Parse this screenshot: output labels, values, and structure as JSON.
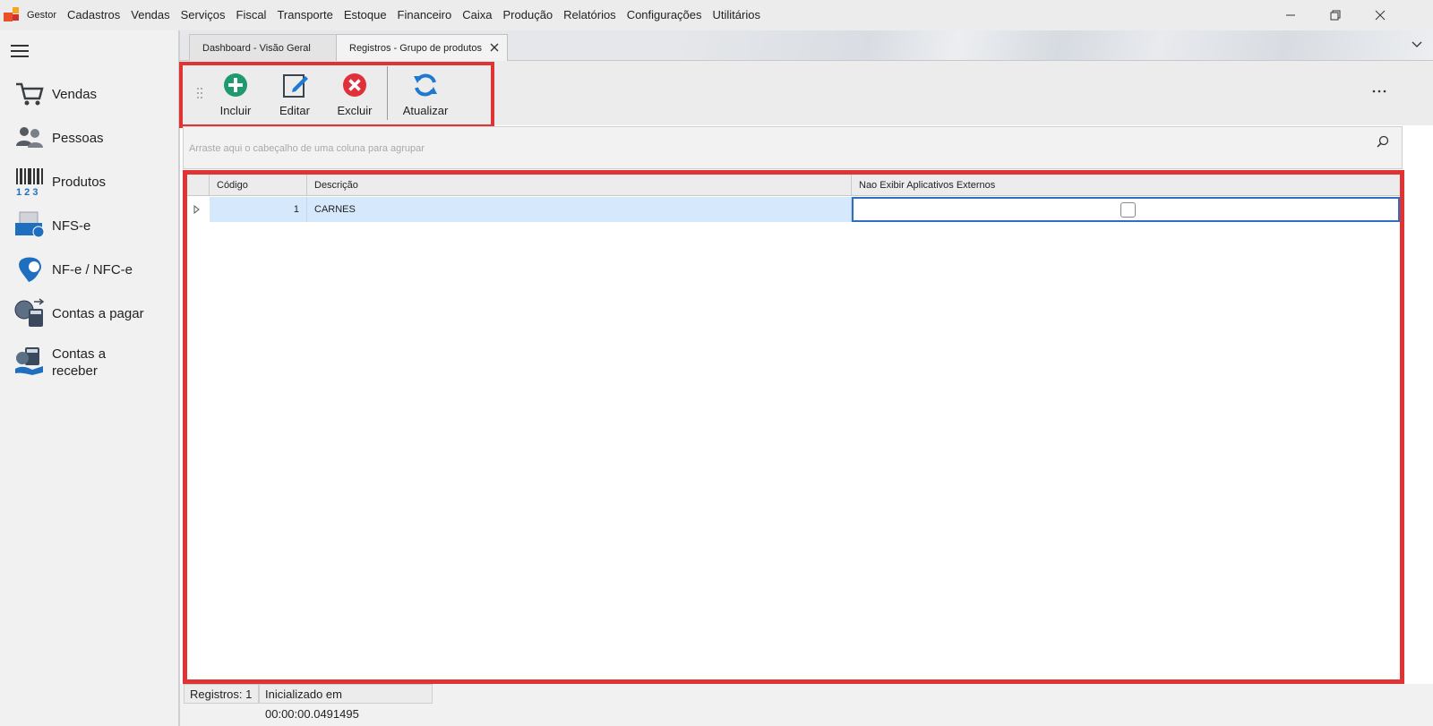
{
  "app": {
    "title": "Gestor",
    "brand_colors": [
      "#e8512a",
      "#f6a623",
      "#d32f2f",
      "#f57c00"
    ]
  },
  "menu": {
    "items": [
      "Gestor",
      "Cadastros",
      "Vendas",
      "Serviços",
      "Fiscal",
      "Transporte",
      "Estoque",
      "Financeiro",
      "Caixa",
      "Produção",
      "Relatórios",
      "Configurações",
      "Utilitários"
    ]
  },
  "window_controls": [
    "minimize-icon",
    "restore-icon",
    "close-icon"
  ],
  "sidebar": {
    "items": [
      {
        "label": "Vendas",
        "icon": "shopping-cart-icon"
      },
      {
        "label": "Pessoas",
        "icon": "people-icon"
      },
      {
        "label": "Produtos",
        "icon": "barcode-icon"
      },
      {
        "label": "NFS-e",
        "icon": "nfse-icon"
      },
      {
        "label": "NF-e / NFC-e",
        "icon": "nfe-icon"
      },
      {
        "label": "Contas a pagar",
        "icon": "bills-to-pay-icon"
      },
      {
        "label": "Contas a receber",
        "icon": "bills-to-receive-icon"
      }
    ]
  },
  "tabs": [
    {
      "label": "Dashboard - Visão Geral",
      "active": false
    },
    {
      "label": "Registros - Grupo de produtos",
      "active": true
    }
  ],
  "toolbar": {
    "include_label": "Incluir",
    "edit_label": "Editar",
    "delete_label": "Excluir",
    "refresh_label": "Atualizar"
  },
  "group_panel": {
    "placeholder": "Arraste aqui o cabeçalho de uma coluna para agrupar"
  },
  "grid": {
    "columns": [
      "Código",
      "Descrição",
      "Nao Exibir Aplicativos Externos"
    ],
    "rows": [
      {
        "codigo": "1",
        "descricao": "CARNES",
        "nao_exibir": false
      }
    ]
  },
  "status": {
    "records": "Registros: 1",
    "initialized": "Inicializado em 00:00:00.0491495"
  },
  "colors": {
    "highlight_frame": "#e03434",
    "selected_row": "#d6e8fb",
    "include_green": "#1e9a6e",
    "delete_red": "#e0303a",
    "refresh_blue": "#1f78d1"
  }
}
